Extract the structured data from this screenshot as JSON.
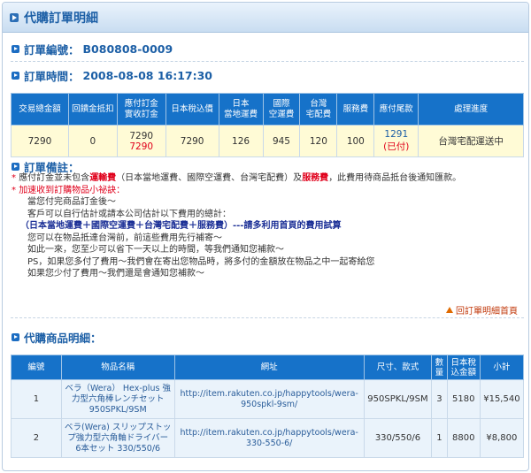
{
  "window": {
    "title": "代購訂單明細"
  },
  "order": {
    "number_label": "訂單編號：",
    "number_value": "B080808-0009",
    "time_label": "訂單時間：",
    "time_value": "2008-08-08 16:17:30"
  },
  "summary_table": {
    "headers": [
      "交易總金額",
      "回饋金抵扣",
      "應付訂金\n實收訂金",
      "日本稅込價",
      "日本\n當地運費",
      "國際\n空運費",
      "台灣\n宅配費",
      "服務費",
      "應付尾款",
      "處理進度"
    ],
    "row": {
      "total": "7290",
      "rebate": "0",
      "deposit_due": "7290",
      "deposit_paid": "7290",
      "jp_price": "7290",
      "jp_shipping": "126",
      "intl_air": "945",
      "tw_delivery": "120",
      "service_fee": "100",
      "balance": "1291",
      "balance_status": "(已付)",
      "progress": "台灣宅配運送中"
    }
  },
  "notes": {
    "heading": "訂單備註：",
    "line1_a": "應付訂金並未包含",
    "line1_b": "運輸費",
    "line1_c": "（日本當地運費、國際空運費、台灣宅配費）及",
    "line1_d": "服務費",
    "line1_e": "，此費用待商品抵台後通知匯款。",
    "tip_heading": "加速收到訂購物品小祕訣：",
    "tip1": "當您付完商品訂金後～",
    "tip2": "客戶可以自行估計或請本公司估計以下費用的總計：",
    "tip3": "（日本當地運費＋國際空運費＋台灣宅配費＋服務費）---請多利用首頁的費用試算",
    "tip4": "您可以在物品抵達台灣前，前這些費用先行補寄～",
    "tip5": "如此一來，您至少可以省下一天以上的時間，等我們通知您補款～",
    "tip6": "PS，如果您多付了費用～我們會在寄出您物品時，將多付的金額放在物品之中一起寄給您",
    "tip7": "如果您少付了費用～我們還是會通知您補款～"
  },
  "back_link": {
    "label": "回訂單明細首頁"
  },
  "items_section": {
    "heading": "代購商品明細：",
    "headers": [
      "編號",
      "物品名稱",
      "網址",
      "尺寸、款式",
      "數\n量",
      "日本稅\n込金額",
      "小計"
    ],
    "rows": [
      {
        "no": "1",
        "name": "ベラ（Wera） Hex-plus 強力型六角棒レンチセット 950SPKL/9SM",
        "url": "http://item.rakuten.co.jp/happytools/wera-950spkl-9sm/",
        "spec": "950SPKL/9SM",
        "qty": "3",
        "price": "5180",
        "subtotal": "¥15,540"
      },
      {
        "no": "2",
        "name": "ベラ(Wera) スリップストップ強力型六角軸ドライバー 6本セット 330/550/6",
        "url": "http://item.rakuten.co.jp/happytools/wera-330-550-6/",
        "spec": "330/550/6",
        "qty": "1",
        "price": "8800",
        "subtotal": "¥8,800"
      }
    ]
  },
  "colors": {
    "header_blue": "#1672c9",
    "title_blue": "#1c5fa6",
    "alert_red": "#e0001b",
    "row_yellow": "#fffbd6"
  },
  "icons": {
    "title": "arrow-right-icon",
    "section": "arrow-right-icon",
    "back": "triangle-up-icon"
  }
}
